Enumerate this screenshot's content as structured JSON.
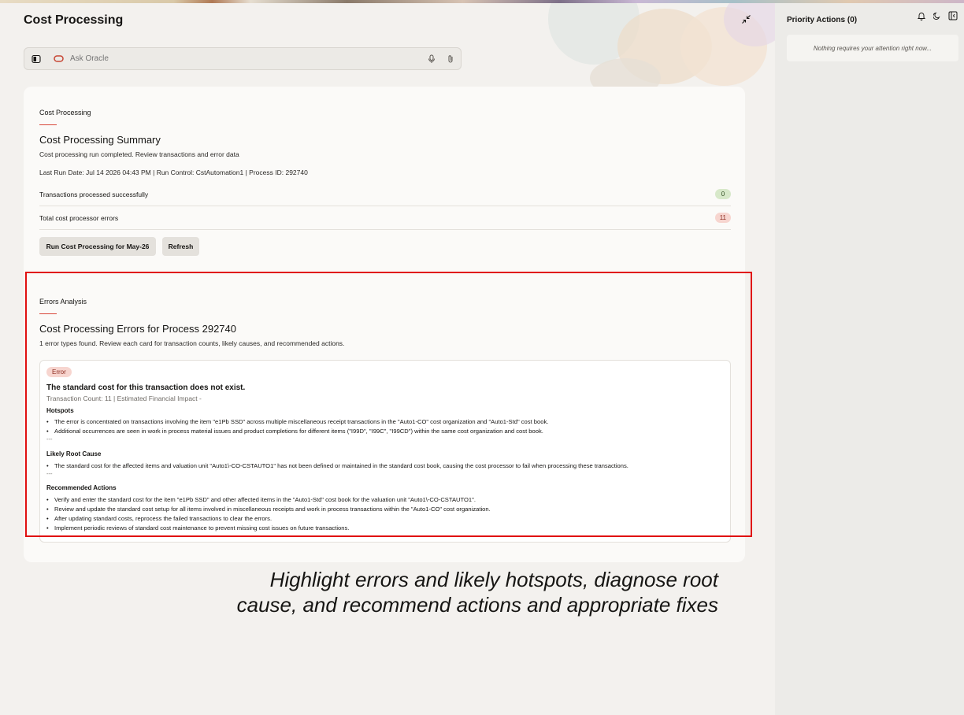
{
  "header": {
    "title": "Cost Processing"
  },
  "search": {
    "placeholder": "Ask Oracle"
  },
  "summary": {
    "section_label": "Cost Processing",
    "title": "Cost Processing Summary",
    "description": "Cost processing run completed. Review transactions and error data",
    "meta": "Last Run Date: Jul 14 2026 04:43 PM | Run Control: CstAutomation1 | Process ID: 292740",
    "stats": [
      {
        "label": "Transactions processed successfully",
        "value": "0",
        "status": "ok"
      },
      {
        "label": "Total cost processor errors",
        "value": "11",
        "status": "error"
      }
    ],
    "buttons": {
      "run": "Run Cost Processing for May-26",
      "refresh": "Refresh"
    }
  },
  "errors": {
    "section_label": "Errors Analysis",
    "title": "Cost Processing Errors for Process 292740",
    "description": "1 error types found. Review each card for transaction counts, likely causes, and recommended actions.",
    "card": {
      "badge": "Error",
      "title": "The standard cost for this transaction does not exist.",
      "subtitle": "Transaction Count: 11 | Estimated Financial Impact -",
      "hotspots_label": "Hotspots",
      "hotspots": [
        "The error is concentrated on transactions involving the item \"e1Pb SSD\" across multiple miscellaneous receipt transactions in the \"Auto1-CO\" cost organization and \"Auto1-Std\" cost book.",
        "Additional occurrences are seen in work in process material issues and product completions for different items (\"I99D\", \"I99C\", \"I99CD\") within the same cost organization and cost book."
      ],
      "root_cause_label": "Likely Root Cause",
      "root_cause": [
        "The standard cost for the affected items and valuation unit \"Auto1\\-CO-CSTAUTO1\" has not been defined or maintained in the standard cost book, causing the cost processor to fail when processing these transactions."
      ],
      "actions_label": "Recommended Actions",
      "actions": [
        "Verify and enter the standard cost for the item \"e1Pb SSD\" and other affected items in the \"Auto1-Std\" cost book for the valuation unit \"Auto1\\-CO-CSTAUTO1\".",
        "Review and update the standard cost setup for all items involved in miscellaneous receipts and work in process transactions within the \"Auto1-CO\" cost organization.",
        "After updating standard costs, reprocess the failed transactions to clear the errors.",
        "Implement periodic reviews of standard cost maintenance to prevent missing cost issues on future transactions."
      ],
      "separator": "---"
    }
  },
  "caption": {
    "line1": "Highlight errors and likely hotspots, diagnose root",
    "line2": "cause, and recommend actions and appropriate fixes"
  },
  "sidebar": {
    "title": "Priority Actions (0)",
    "empty_message": "Nothing requires your attention right now..."
  },
  "colors": {
    "accent_red": "#d8473a",
    "highlight_border": "#e01010",
    "success_badge": "#d7e8c9",
    "error_badge": "#f7d5cf"
  },
  "icons": [
    "sidebar-toggle-icon",
    "oracle-logo-icon",
    "microphone-icon",
    "paperclip-icon",
    "collapse-icon",
    "bell-icon",
    "moon-icon",
    "panel-close-icon"
  ]
}
